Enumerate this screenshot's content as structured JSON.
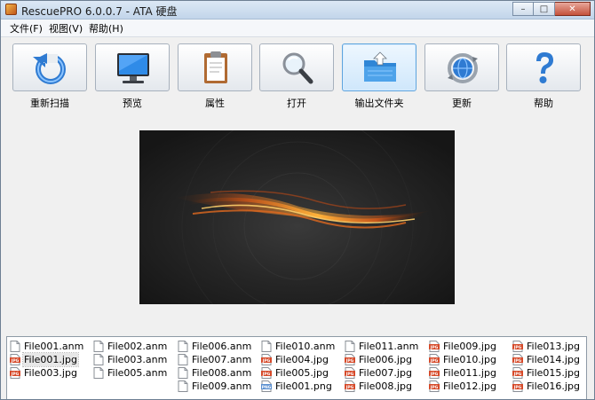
{
  "window": {
    "title": "RescuePRO 6.0.0.7 - ATA 硬盘",
    "controls": {
      "minimize": "–",
      "maximize": "□",
      "close": "✕"
    }
  },
  "menu": [
    {
      "label": "文件(F)"
    },
    {
      "label": "视图(V)"
    },
    {
      "label": "帮助(H)"
    }
  ],
  "toolbar": [
    {
      "label": "重新扫描",
      "icon": "refresh-icon"
    },
    {
      "label": "预览",
      "icon": "monitor-icon"
    },
    {
      "label": "属性",
      "icon": "clipboard-icon"
    },
    {
      "label": "打开",
      "icon": "magnifier-icon"
    },
    {
      "label": "输出文件夹",
      "icon": "folder-export-icon"
    },
    {
      "label": "更新",
      "icon": "update-globe-icon"
    },
    {
      "label": "帮助",
      "icon": "help-icon"
    }
  ],
  "preview": {
    "icon": "image-preview"
  },
  "files": [
    [
      "File001.anm",
      "File001.jpg",
      "File003.jpg"
    ],
    [
      "File002.anm",
      "File003.anm",
      "File005.anm"
    ],
    [
      "File006.anm",
      "File007.anm",
      "File008.anm",
      "File009.anm"
    ],
    [
      "File010.anm",
      "File004.jpg",
      "File005.jpg",
      "File001.png"
    ],
    [
      "File011.anm",
      "File006.jpg",
      "File007.jpg",
      "File008.jpg"
    ],
    [
      "File009.jpg",
      "File010.jpg",
      "File011.jpg",
      "File012.jpg"
    ],
    [
      "File013.jpg",
      "File014.jpg",
      "File015.jpg",
      "File016.jpg"
    ]
  ],
  "selected_file": "File001.jpg"
}
